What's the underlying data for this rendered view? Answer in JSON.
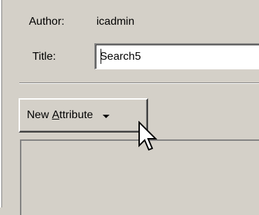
{
  "author": {
    "label": "Author:",
    "value": "icadmin"
  },
  "title": {
    "label": "Title:",
    "value": "Search5"
  },
  "new_attribute_button": {
    "label_prefix": "New ",
    "label_mnemonic": "A",
    "label_suffix": "ttribute",
    "icon": "dropdown-arrow-icon"
  },
  "cursor": {
    "icon": "mouse-pointer-icon"
  }
}
